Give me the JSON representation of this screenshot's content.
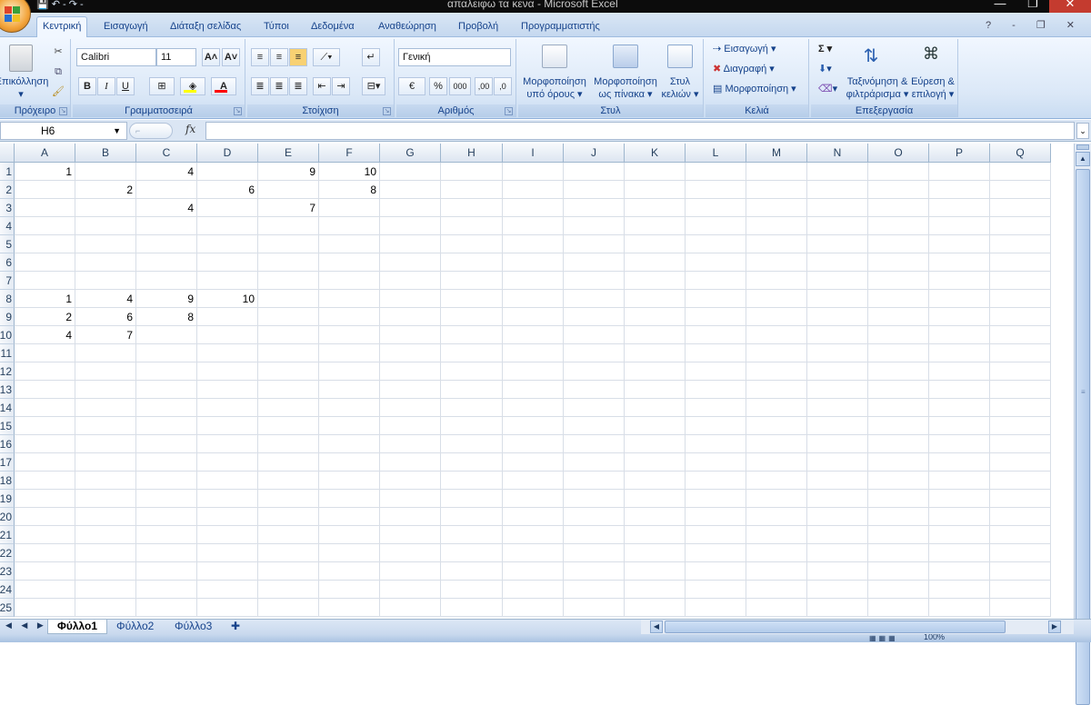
{
  "window": {
    "title": "απαλειφω τα κενα - Microsoft Excel",
    "controls": [
      "—",
      "❐",
      "✕"
    ]
  },
  "qat": {
    "save": "💾",
    "undo": "↶ -",
    "redo": "↷ -"
  },
  "tabs": [
    "Κεντρική",
    "Εισαγωγή",
    "Διάταξη σελίδας",
    "Τύποι",
    "Δεδομένα",
    "Αναθεώρηση",
    "Προβολή",
    "Προγραμματιστής"
  ],
  "help_controls": "? - ❐ ✕",
  "ribbon": {
    "clipboard": {
      "label": "Πρόχειρο",
      "paste": "Επικόλληση",
      "paste_arrow": "▾"
    },
    "font": {
      "label": "Γραμματοσειρά",
      "family": "Calibri",
      "size": "11",
      "grow": "A˄",
      "shrink": "A˅",
      "bold": "B",
      "italic": "I",
      "underline": "U",
      "fill_color": "#ffff00",
      "font_color": "#ff0000"
    },
    "alignment": {
      "label": "Στοίχιση"
    },
    "number": {
      "label": "Αριθμός",
      "format": "Γενική",
      "currency": "€",
      "percent": "%",
      "thousands": "000",
      "inc_dec": ",00",
      "dec_dec": ",0"
    },
    "styles": {
      "label": "Στυλ",
      "conditional": [
        "Μορφοποίηση",
        "υπό όρους ▾"
      ],
      "as_table": [
        "Μορφοποίηση",
        "ως πίνακα ▾"
      ],
      "cell_styles": [
        "Στυλ",
        "κελιών ▾"
      ]
    },
    "cells": {
      "label": "Κελιά",
      "insert": "Εισαγωγή ▾",
      "delete": "Διαγραφή ▾",
      "format": "Μορφοποίηση ▾"
    },
    "editing": {
      "label": "Επεξεργασία",
      "sum": "Σ ▾",
      "fill": "▾",
      "clear": "▾",
      "sort": [
        "Ταξινόμηση &",
        "φιλτράρισμα ▾"
      ],
      "find": [
        "Εύρεση &",
        "επιλογή ▾"
      ]
    }
  },
  "formula_bar": {
    "name_box": "H6",
    "fx": "fx",
    "content": ""
  },
  "columns": [
    "A",
    "B",
    "C",
    "D",
    "E",
    "F",
    "G",
    "H",
    "I",
    "J",
    "K",
    "L",
    "M",
    "N",
    "O",
    "P",
    "Q"
  ],
  "rows": [
    "1",
    "2",
    "3",
    "4",
    "5",
    "6",
    "7",
    "8",
    "9",
    "10",
    "11",
    "12",
    "13",
    "14",
    "15",
    "16",
    "17",
    "18",
    "19",
    "20",
    "21",
    "22",
    "23",
    "24",
    "25"
  ],
  "cells": [
    [
      "1",
      "",
      "4",
      "",
      "9",
      "10"
    ],
    [
      "",
      "2",
      "",
      "6",
      "",
      "8"
    ],
    [
      "",
      "",
      "4",
      "",
      "7",
      ""
    ],
    [],
    [],
    [],
    [],
    [
      "1",
      "4",
      "9",
      "10",
      "",
      ""
    ],
    [
      "2",
      "6",
      "8",
      "",
      "",
      ""
    ],
    [
      "4",
      "7",
      "",
      "",
      "",
      ""
    ]
  ],
  "sheets": {
    "nav": "◀ ◀ ▶ ▶",
    "tabs": [
      "Φύλλο1",
      "Φύλλο2",
      "Φύλλο3"
    ],
    "active": "Φύλλο1"
  },
  "status": {
    "zoom": "100%"
  }
}
